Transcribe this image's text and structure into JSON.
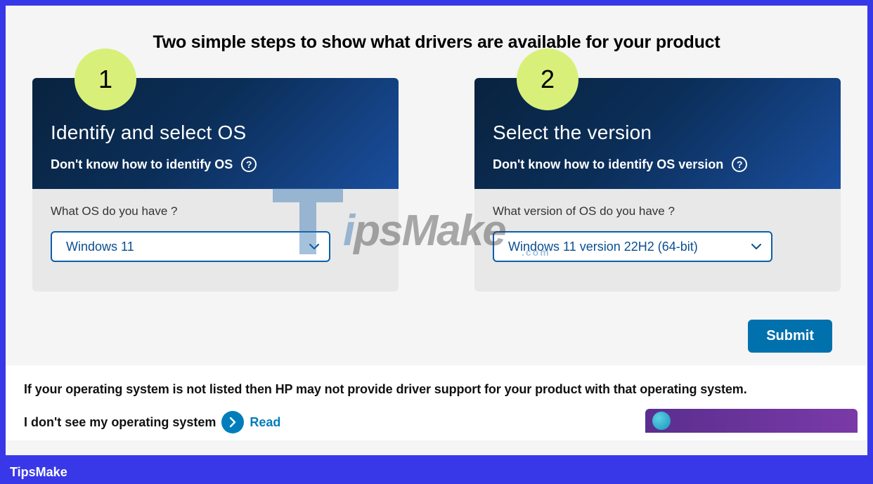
{
  "heading": "Two simple steps to show what drivers are available for your product",
  "step1": {
    "badge": "1",
    "title": "Identify and select OS",
    "help_text": "Don't know how to identify OS",
    "question": "What OS do you have ?",
    "selected": "Windows 11"
  },
  "step2": {
    "badge": "2",
    "title": "Select the version",
    "help_text": "Don't know how to identify OS version",
    "question": "What version of OS do you have ?",
    "selected": "Windows 11 version 22H2 (64-bit)"
  },
  "submit_label": "Submit",
  "note": "If your operating system is not listed then HP may not provide driver support for your product with that operating system.",
  "secondary_note_prefix": "I don't see my operating system",
  "read_label": "Read",
  "watermark_text": "ipsMake",
  "watermark_com": ".com",
  "footer": "TipsMake"
}
